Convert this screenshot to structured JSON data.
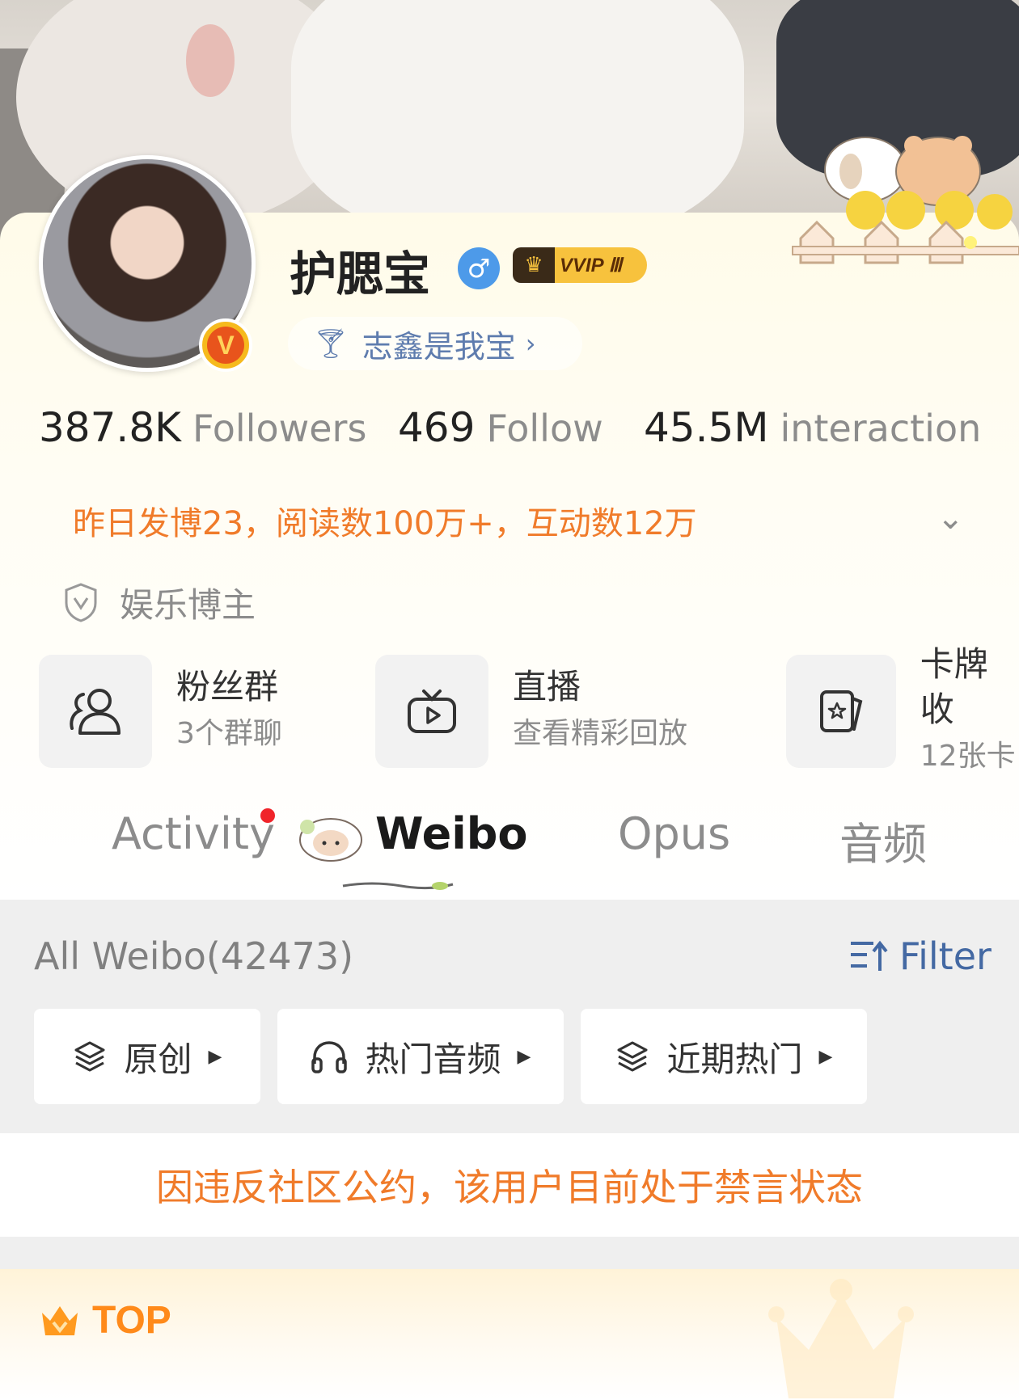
{
  "profile": {
    "username": "护腮宝",
    "gender_symbol": "♂",
    "vip_label": "VVIP Ⅲ",
    "fan_tag": "志鑫是我宝",
    "verified_badge": "V"
  },
  "stats": [
    {
      "value": "387.8K",
      "label": "Followers"
    },
    {
      "value": "469",
      "label": "Follow"
    },
    {
      "value": "45.5M",
      "label": "interaction"
    }
  ],
  "insight_text": "昨日发博23，阅读数100万+，互动数12万",
  "category": "娱乐博主",
  "features": [
    {
      "title": "粉丝群",
      "subtitle": "3个群聊",
      "icon": "people-icon"
    },
    {
      "title": "直播",
      "subtitle": "查看精彩回放",
      "icon": "tv-play-icon"
    },
    {
      "title": "卡牌收",
      "subtitle": "12张卡",
      "icon": "card-star-icon"
    }
  ],
  "tabs": [
    "Activity",
    "Weibo",
    "Opus",
    "音频"
  ],
  "active_tab": "Weibo",
  "feed": {
    "all_label": "All Weibo(42473)",
    "filter_label": "Filter",
    "chips": [
      {
        "label": "原创",
        "icon": "layers-icon"
      },
      {
        "label": "热门音频",
        "icon": "headphones-icon"
      },
      {
        "label": "近期热门",
        "icon": "layers-icon"
      }
    ]
  },
  "notice": "因违反社区公约，该用户目前处于禁言状态",
  "top_label": "TOP",
  "colors": {
    "accent_orange": "#f07b2a",
    "link_blue": "#4469a3",
    "gender_blue": "#4d9ae9",
    "vip_gold": "#f7c23d",
    "alert_red": "#f0242a"
  }
}
